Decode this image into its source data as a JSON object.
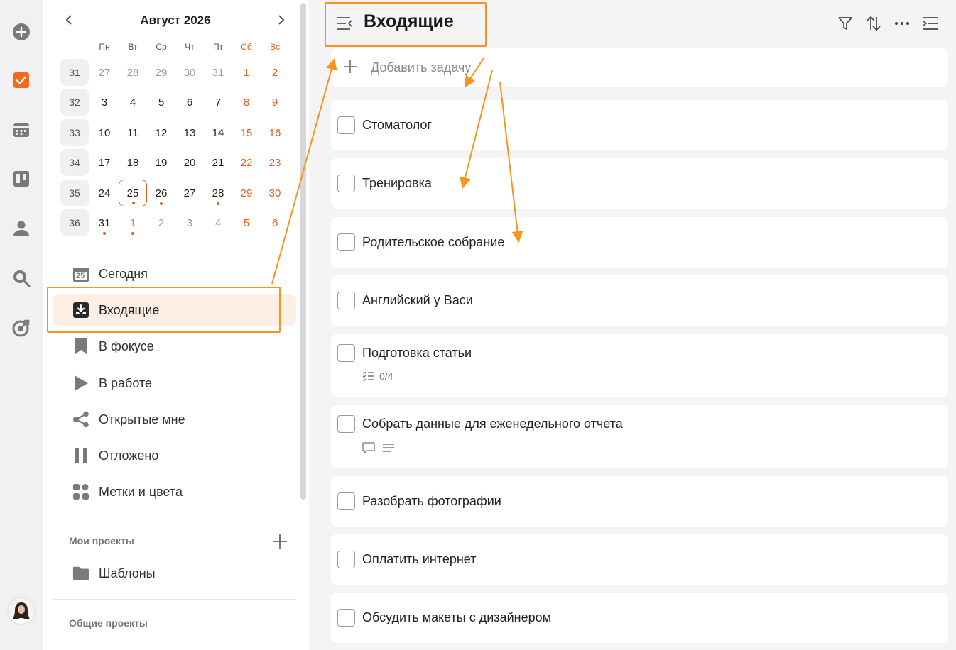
{
  "calendar": {
    "month_title": "Август 2026",
    "weekdays": [
      "Пн",
      "Вт",
      "Ср",
      "Чт",
      "Пт",
      "Сб",
      "Вс"
    ],
    "weeks": [
      {
        "num": "31",
        "days": [
          "27",
          "28",
          "29",
          "30",
          "31",
          "1",
          "2"
        ]
      },
      {
        "num": "32",
        "days": [
          "3",
          "4",
          "5",
          "6",
          "7",
          "8",
          "9"
        ]
      },
      {
        "num": "33",
        "days": [
          "10",
          "11",
          "12",
          "13",
          "14",
          "15",
          "16"
        ]
      },
      {
        "num": "34",
        "days": [
          "17",
          "18",
          "19",
          "20",
          "21",
          "22",
          "23"
        ]
      },
      {
        "num": "35",
        "days": [
          "24",
          "25",
          "26",
          "27",
          "28",
          "29",
          "30"
        ]
      },
      {
        "num": "36",
        "days": [
          "31",
          "1",
          "2",
          "3",
          "4",
          "5",
          "6"
        ]
      }
    ],
    "today": "25",
    "accent_color": "#e2601c"
  },
  "sidebar": {
    "today_icon_text": "25",
    "nav": [
      {
        "label": "Сегодня",
        "icon": "calendar-25-icon"
      },
      {
        "label": "Входящие",
        "icon": "inbox-icon"
      },
      {
        "label": "В фокусе",
        "icon": "bookmark-icon"
      },
      {
        "label": "В работе",
        "icon": "play-icon"
      },
      {
        "label": "Открытые мне",
        "icon": "share-icon"
      },
      {
        "label": "Отложено",
        "icon": "pause-icon"
      },
      {
        "label": "Метки и цвета",
        "icon": "tags-grid-icon"
      }
    ],
    "my_projects_label": "Мои проекты",
    "projects": [
      {
        "label": "Шаблоны",
        "icon": "folder-icon"
      }
    ],
    "shared_projects_label": "Общие проекты"
  },
  "main": {
    "title": "Входящие",
    "add_task_placeholder": "Добавить задачу",
    "tasks": [
      {
        "title": "Стоматолог"
      },
      {
        "title": "Тренировка"
      },
      {
        "title": "Родительское собрание"
      },
      {
        "title": "Английский у Васи"
      },
      {
        "title": "Подготовка статьи",
        "subtasks": "0/4"
      },
      {
        "title": "Собрать данные для еженедельного отчета"
      },
      {
        "title": "Разобрать фотографии"
      },
      {
        "title": "Оплатить интернет"
      },
      {
        "title": "Обсудить макеты с дизайнером"
      }
    ]
  },
  "annotation_color": "#f7931e"
}
